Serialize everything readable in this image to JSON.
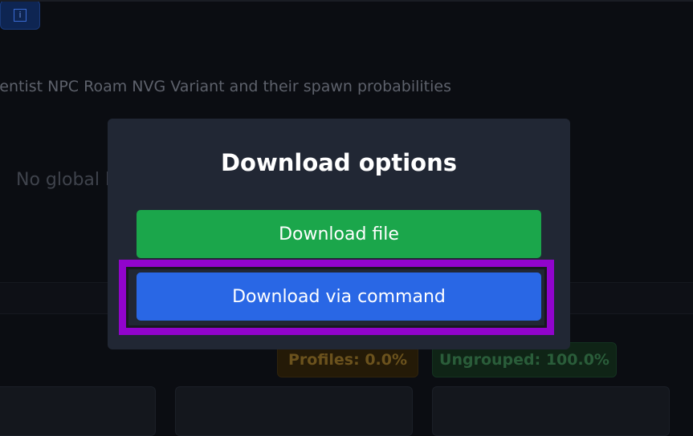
{
  "background": {
    "subtitle": "ientist NPC Roam NVG Variant and their spawn probabilities",
    "empty_message": "No global l",
    "badges": {
      "profiles": "Profiles: 0.0%",
      "ungrouped": "Ungrouped: 100.0%",
      "info_icon": "info-icon"
    }
  },
  "modal": {
    "title": "Download options",
    "download_file_label": "Download file",
    "download_command_label": "Download via command"
  },
  "colors": {
    "modal_bg": "#212734",
    "download_file_bg": "#1ba64b",
    "download_command_bg": "#2967e5",
    "highlight": "#9104cc"
  }
}
